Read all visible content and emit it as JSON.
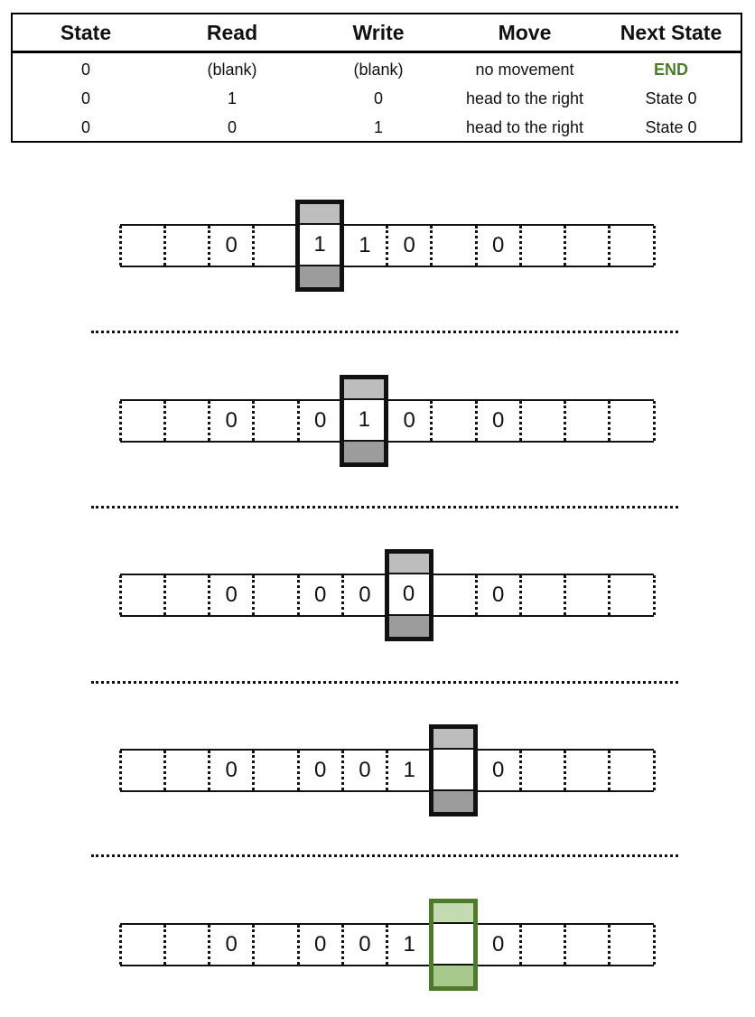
{
  "table": {
    "headers": [
      "State",
      "Read",
      "Write",
      "Move",
      "Next State"
    ],
    "rows": [
      [
        "0",
        "(blank)",
        "(blank)",
        "no movement",
        "END"
      ],
      [
        "0",
        "1",
        "0",
        "head to the right",
        "State 0"
      ],
      [
        "0",
        "0",
        "1",
        "head to the right",
        "State 0"
      ]
    ],
    "end_color": "#4e7a2b"
  },
  "steps": [
    {
      "cells": [
        "",
        "",
        "0",
        "",
        "1",
        "1",
        "0",
        "",
        "0",
        "",
        "",
        ""
      ],
      "head_index": 4,
      "head_style": "gray"
    },
    {
      "cells": [
        "",
        "",
        "0",
        "",
        "0",
        "1",
        "0",
        "",
        "0",
        "",
        "",
        ""
      ],
      "head_index": 5,
      "head_style": "gray"
    },
    {
      "cells": [
        "",
        "",
        "0",
        "",
        "0",
        "0",
        "0",
        "",
        "0",
        "",
        "",
        ""
      ],
      "head_index": 6,
      "head_style": "gray"
    },
    {
      "cells": [
        "",
        "",
        "0",
        "",
        "0",
        "0",
        "1",
        "",
        "0",
        "",
        "",
        ""
      ],
      "head_index": 7,
      "head_style": "gray"
    },
    {
      "cells": [
        "",
        "",
        "0",
        "",
        "0",
        "0",
        "1",
        "",
        "0",
        "",
        "",
        ""
      ],
      "head_index": 7,
      "head_style": "green"
    }
  ],
  "colors": {
    "head_gray_top": "#bdbdbd",
    "head_gray_bottom": "#9c9c9c",
    "head_green_border": "#4e7a2b",
    "head_green_top": "#c4dab1",
    "head_green_bottom": "#a7c98c"
  }
}
